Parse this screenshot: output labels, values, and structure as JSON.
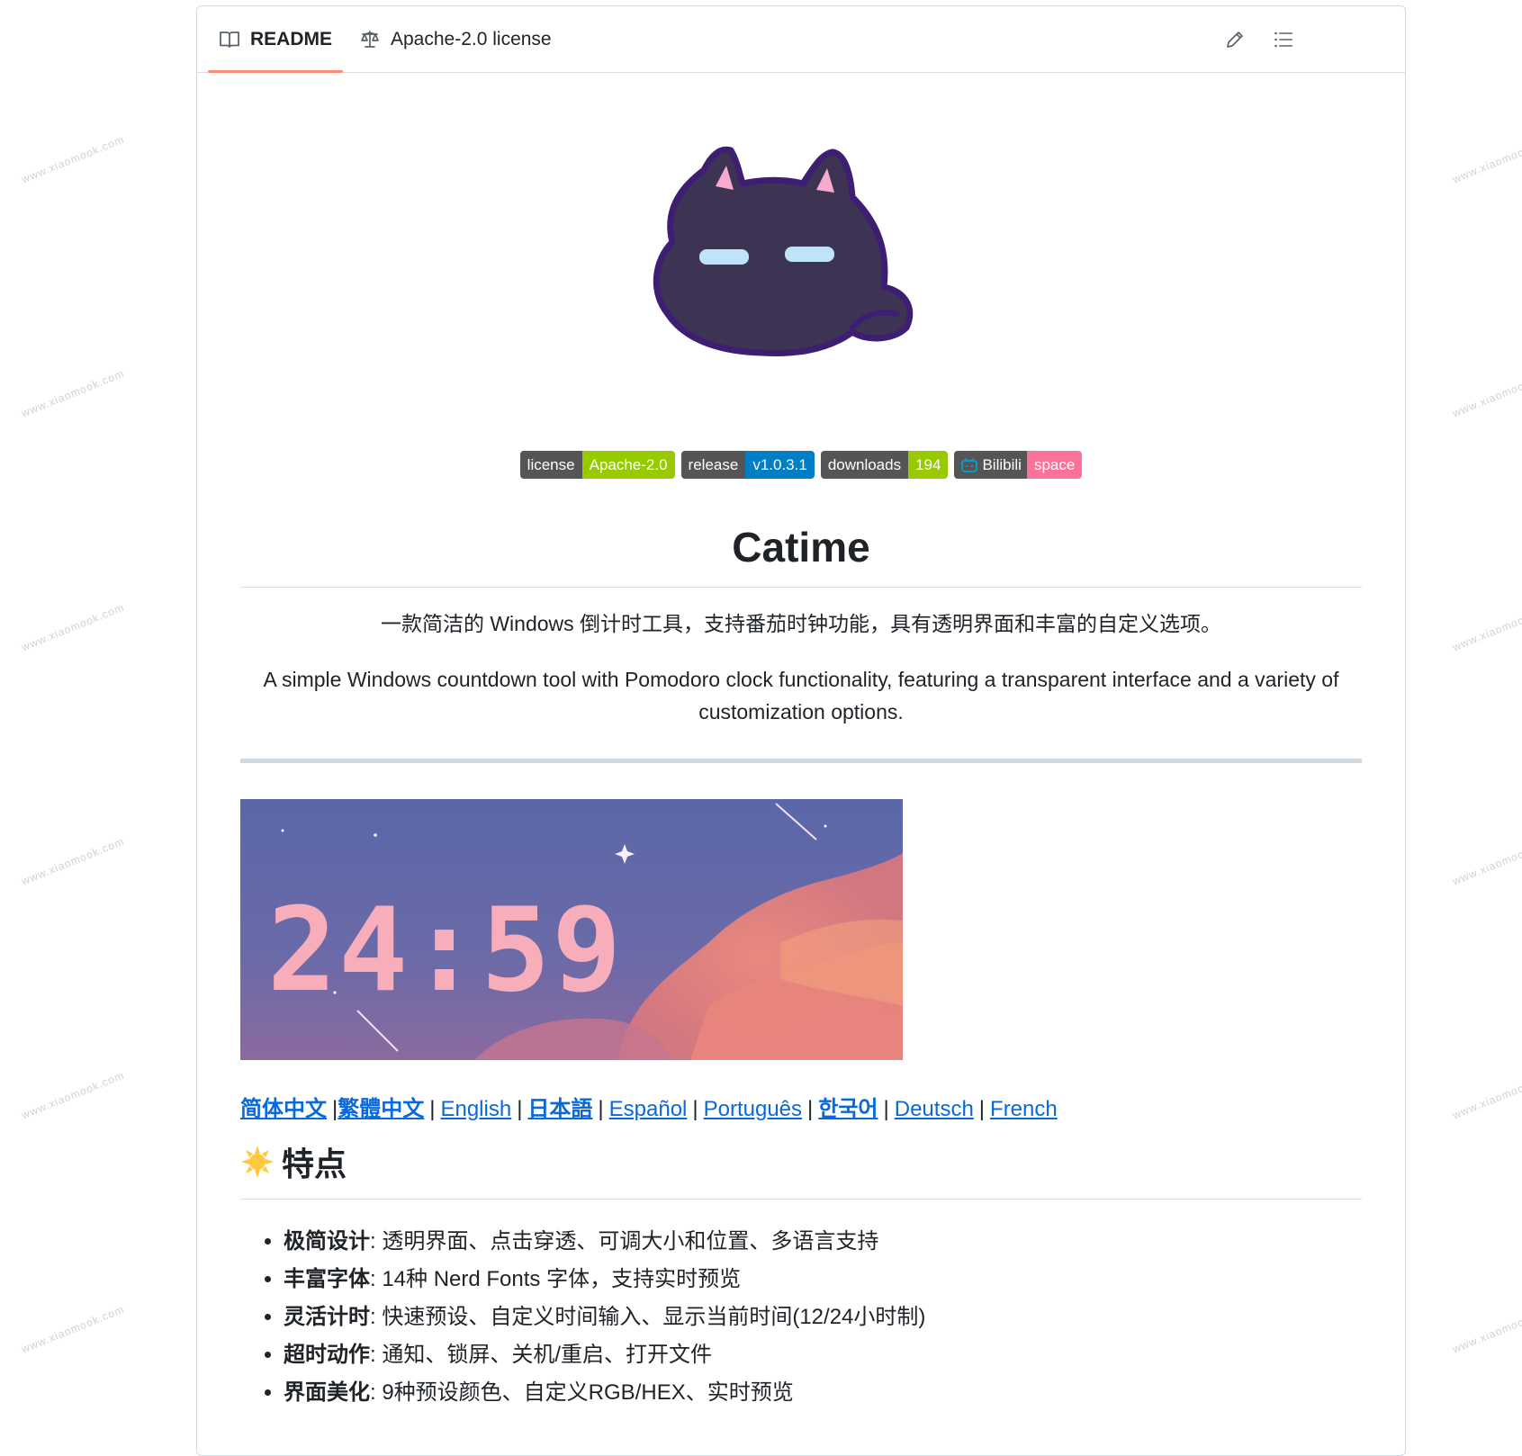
{
  "tabs": {
    "readme": "README",
    "license": "Apache-2.0 license"
  },
  "badges": [
    {
      "label": "license",
      "value": "Apache-2.0",
      "color": "#97ca00"
    },
    {
      "label": "release",
      "value": "v1.0.3.1",
      "color": "#007ec6"
    },
    {
      "label": "downloads",
      "value": "194",
      "color": "#97ca00"
    },
    {
      "label": "Bilibili",
      "value": "space",
      "color": "#fb7299"
    }
  ],
  "title": "Catime",
  "desc_cn": "一款简洁的 Windows 倒计时工具，支持番茄时钟功能，具有透明界面和丰富的自定义选项。",
  "desc_en": "A simple Windows countdown tool with Pomodoro clock functionality, featuring a transparent interface and a variety of customization options.",
  "screenshot_time": "24:59",
  "languages": [
    {
      "label": "简体中文",
      "bold": true
    },
    {
      "label": "繁體中文",
      "bold": true
    },
    {
      "label": "English",
      "bold": false
    },
    {
      "label": "日本語",
      "bold": true
    },
    {
      "label": "Español",
      "bold": false
    },
    {
      "label": "Português",
      "bold": false
    },
    {
      "label": "한국어",
      "bold": true
    },
    {
      "label": "Deutsch",
      "bold": false
    },
    {
      "label": "French",
      "bold": false
    }
  ],
  "features_heading": "特点",
  "features": [
    {
      "name": "极简设计",
      "text": ": 透明界面、点击穿透、可调大小和位置、多语言支持"
    },
    {
      "name": "丰富字体",
      "text": ": 14种 Nerd Fonts 字体，支持实时预览"
    },
    {
      "name": "灵活计时",
      "text": ": 快速预设、自定义时间输入、显示当前时间(12/24小时制)"
    },
    {
      "name": "超时动作",
      "text": ": 通知、锁屏、关机/重启、打开文件"
    },
    {
      "name": "界面美化",
      "text": ": 9种预设颜色、自定义RGB/HEX、实时预览"
    }
  ],
  "watermark": "www.xiaomook.com",
  "colors": {
    "link": "#0969da",
    "tab_underline": "#fd8c73",
    "border": "#d0d7de"
  }
}
